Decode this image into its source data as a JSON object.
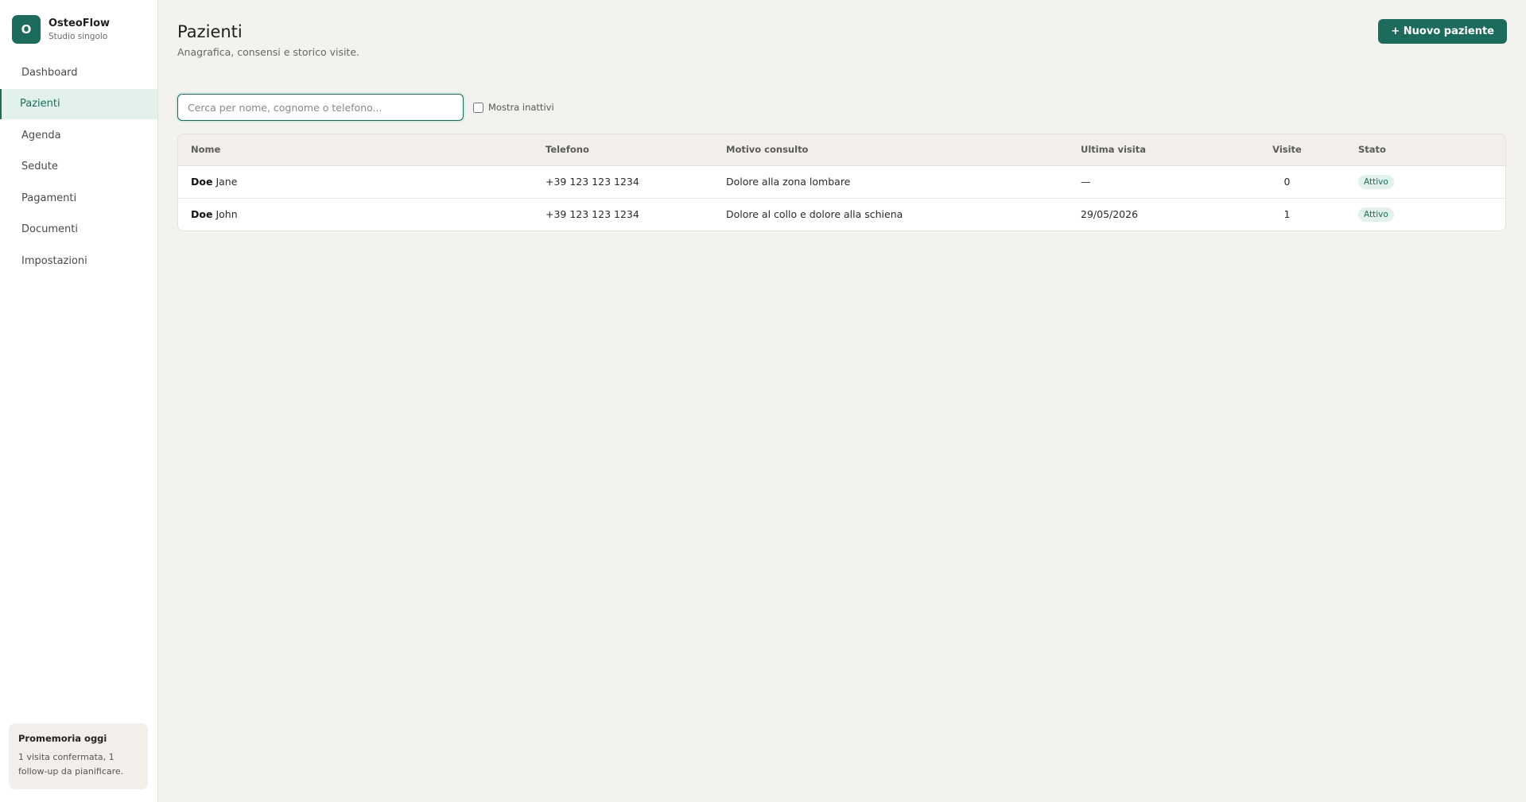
{
  "brand": {
    "initial": "O",
    "name": "OsteoFlow",
    "subtitle": "Studio singolo"
  },
  "sidebar": {
    "items": [
      {
        "label": "Dashboard",
        "active": false
      },
      {
        "label": "Pazienti",
        "active": true
      },
      {
        "label": "Agenda",
        "active": false
      },
      {
        "label": "Sedute",
        "active": false
      },
      {
        "label": "Pagamenti",
        "active": false
      },
      {
        "label": "Documenti",
        "active": false
      },
      {
        "label": "Impostazioni",
        "active": false
      }
    ],
    "reminder": {
      "title": "Promemoria oggi",
      "text": "1 visita confermata, 1 follow-up da pianificare."
    }
  },
  "header": {
    "title": "Pazienti",
    "subtitle": "Anagrafica, consensi e storico visite.",
    "new_button": "+ Nuovo paziente"
  },
  "search": {
    "placeholder": "Cerca per nome, cognome o telefono...",
    "value": ""
  },
  "filter": {
    "show_inactive_label": "Mostra inattivi",
    "checked": false
  },
  "table": {
    "columns": [
      "Nome",
      "Telefono",
      "Motivo consulto",
      "Ultima visita",
      "Visite",
      "Stato"
    ],
    "rows": [
      {
        "surname": "Doe",
        "name": "Jane",
        "phone": "+39 123 123 1234",
        "reason": "Dolore alla zona lombare",
        "last_visit": "—",
        "visits": "0",
        "status": "Attivo"
      },
      {
        "surname": "Doe",
        "name": "John",
        "phone": "+39 123 123 1234",
        "reason": "Dolore al collo e dolore alla schiena",
        "last_visit": "29/05/2026",
        "visits": "1",
        "status": "Attivo"
      }
    ]
  },
  "colors": {
    "accent": "#1d6b5c",
    "accent_light": "#e3f1ec",
    "background": "#f4f2ee"
  }
}
